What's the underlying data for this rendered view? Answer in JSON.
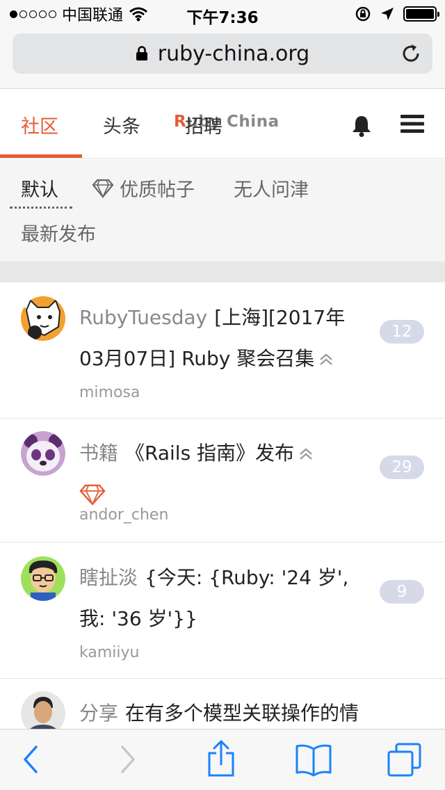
{
  "status_bar": {
    "carrier": "中国联通",
    "time": "下午7:36"
  },
  "browser": {
    "url": "ruby-china.org"
  },
  "nav": {
    "tabs": [
      "社区",
      "头条",
      "招聘"
    ],
    "brand_r": "R",
    "brand_rest": "uby China"
  },
  "filters": {
    "default": "默认",
    "excellent": "优质帖子",
    "no_reply": "无人问津",
    "latest": "最新发布"
  },
  "topics": [
    {
      "node": "RubyTuesday",
      "title_line1": "[上海][2017年",
      "title_line2": "03月07日] Ruby 聚会召集",
      "user": "mimosa",
      "replies": "12"
    },
    {
      "node": "书籍",
      "title_line1": "《Rails 指南》发布",
      "user": "andor_chen",
      "replies": "29"
    },
    {
      "node": "瞎扯淡",
      "title_line1": "{今天: {Ruby: '24 岁',",
      "title_line2": "我: '36 岁'}}",
      "user": "kamiiyu",
      "replies": "9"
    },
    {
      "node": "分享",
      "title_line1": "在有多个模型关联操作的情"
    }
  ],
  "colors": {
    "accent": "#e35d36",
    "badge": "#d6dae8",
    "ios_blue": "#1a82fb"
  }
}
